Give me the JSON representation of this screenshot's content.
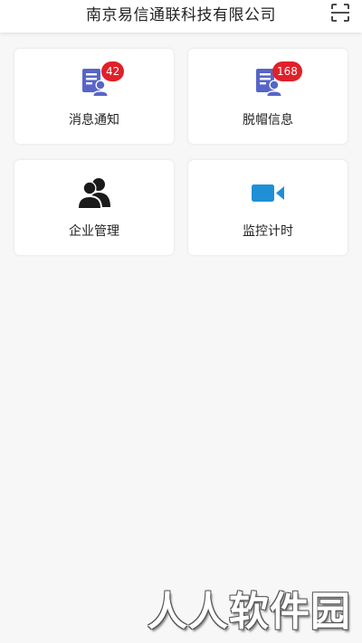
{
  "header": {
    "title": "南京易信通联科技有限公司",
    "scan_icon": "scan-icon"
  },
  "tiles": [
    {
      "label": "消息通知",
      "icon": "document-user-icon",
      "badge": "42"
    },
    {
      "label": "脱帽信息",
      "icon": "document-user-icon",
      "badge": "168"
    },
    {
      "label": "企业管理",
      "icon": "users-icon"
    },
    {
      "label": "监控计时",
      "icon": "video-camera-icon"
    }
  ],
  "colors": {
    "doc_icon": "#5865c8",
    "badge": "#e0202a",
    "camera": "#1f8fd6",
    "users": "#1a1a1a"
  },
  "watermark": "人人软件园"
}
